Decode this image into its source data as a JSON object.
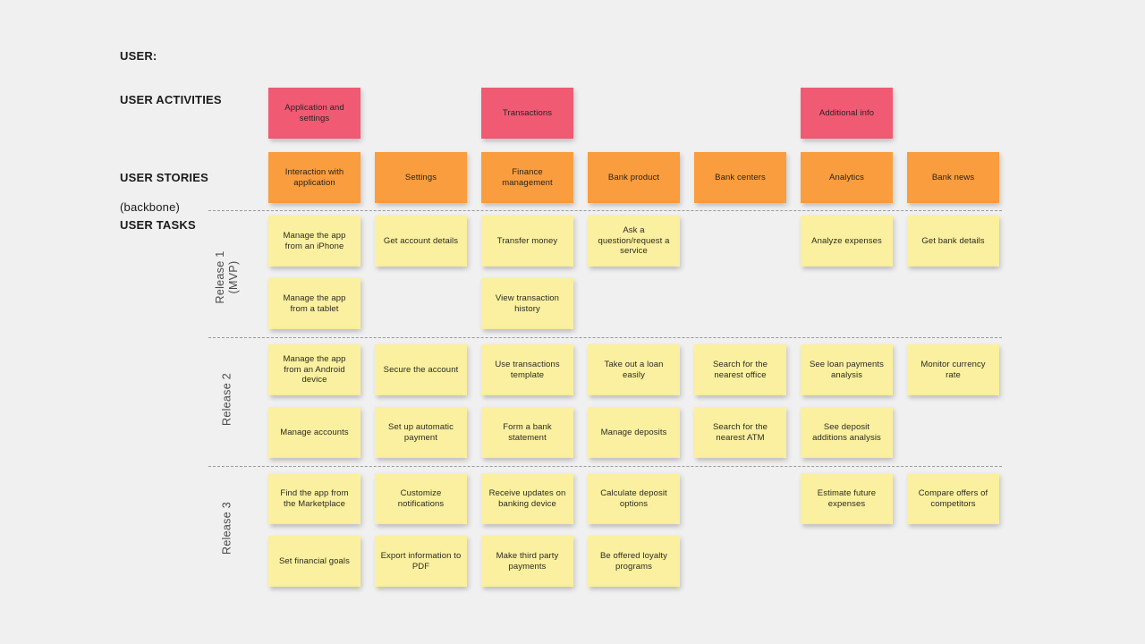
{
  "board": {
    "background_color": "#f0f0f0",
    "colors": {
      "activity": "#f05a73",
      "story": "#f99d3e",
      "task": "#fbf0a0",
      "divider": "#9a9a9a"
    }
  },
  "row_labels": {
    "user": "USER:",
    "user_activities": "USER ACTIVITIES",
    "user_stories": "USER STORIES",
    "user_stories_sub": "(backbone)",
    "user_tasks": "USER TASKS"
  },
  "releases": [
    {
      "id": "release-1",
      "label": "Release 1\n(MVP)"
    },
    {
      "id": "release-2",
      "label": "Release 2"
    },
    {
      "id": "release-3",
      "label": "Release 3"
    }
  ],
  "activities": [
    {
      "label": "Application and settings",
      "column": 1
    },
    {
      "label": "Transactions",
      "column": 3
    },
    {
      "label": "Additional info",
      "column": 6
    }
  ],
  "stories": [
    {
      "label": "Interaction with application",
      "column": 1
    },
    {
      "label": "Settings",
      "column": 2
    },
    {
      "label": "Finance management",
      "column": 3
    },
    {
      "label": "Bank product",
      "column": 4
    },
    {
      "label": "Bank centers",
      "column": 5
    },
    {
      "label": "Analytics",
      "column": 6
    },
    {
      "label": "Bank news",
      "column": 7
    }
  ],
  "tasks": {
    "release_1": [
      {
        "label": "Manage the app from an iPhone",
        "column": 1,
        "row": 1
      },
      {
        "label": "Get account details",
        "column": 2,
        "row": 1
      },
      {
        "label": "Transfer money",
        "column": 3,
        "row": 1
      },
      {
        "label": "Ask a question/request a service",
        "column": 4,
        "row": 1
      },
      {
        "label": "Analyze expenses",
        "column": 6,
        "row": 1
      },
      {
        "label": "Get bank details",
        "column": 7,
        "row": 1
      },
      {
        "label": "Manage the app from a tablet",
        "column": 1,
        "row": 2
      },
      {
        "label": "View transaction history",
        "column": 3,
        "row": 2
      }
    ],
    "release_2": [
      {
        "label": "Manage the app from an Android device",
        "column": 1,
        "row": 1
      },
      {
        "label": "Secure the account",
        "column": 2,
        "row": 1
      },
      {
        "label": "Use transactions template",
        "column": 3,
        "row": 1
      },
      {
        "label": "Take out a loan easily",
        "column": 4,
        "row": 1
      },
      {
        "label": "Search for the nearest office",
        "column": 5,
        "row": 1
      },
      {
        "label": "See loan payments analysis",
        "column": 6,
        "row": 1
      },
      {
        "label": "Monitor currency rate",
        "column": 7,
        "row": 1
      },
      {
        "label": "Manage accounts",
        "column": 1,
        "row": 2
      },
      {
        "label": "Set up automatic payment",
        "column": 2,
        "row": 2
      },
      {
        "label": "Form a bank statement",
        "column": 3,
        "row": 2
      },
      {
        "label": "Manage deposits",
        "column": 4,
        "row": 2
      },
      {
        "label": "Search for the nearest ATM",
        "column": 5,
        "row": 2
      },
      {
        "label": "See deposit additions analysis",
        "column": 6,
        "row": 2
      }
    ],
    "release_3": [
      {
        "label": "Find the app from the Marketplace",
        "column": 1,
        "row": 1
      },
      {
        "label": "Customize notifications",
        "column": 2,
        "row": 1
      },
      {
        "label": "Receive updates on banking device",
        "column": 3,
        "row": 1
      },
      {
        "label": "Calculate deposit options",
        "column": 4,
        "row": 1
      },
      {
        "label": "Estimate future expenses",
        "column": 6,
        "row": 1
      },
      {
        "label": "Compare offers of competitors",
        "column": 7,
        "row": 1
      },
      {
        "label": "Set financial goals",
        "column": 1,
        "row": 2
      },
      {
        "label": "Export information to PDF",
        "column": 2,
        "row": 2
      },
      {
        "label": "Make third party payments",
        "column": 3,
        "row": 2
      },
      {
        "label": "Be offered loyalty programs",
        "column": 4,
        "row": 2
      }
    ]
  }
}
